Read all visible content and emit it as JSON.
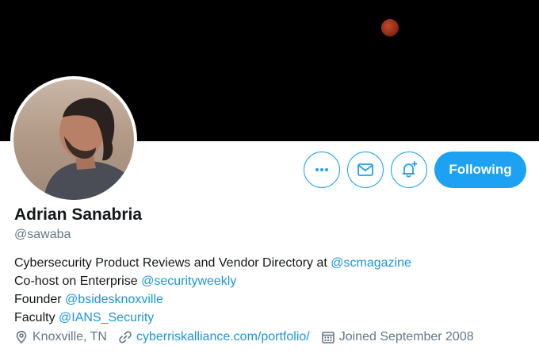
{
  "profile": {
    "name": "Adrian Sanabria",
    "handle": "@sawaba",
    "follow_label": "Following"
  },
  "bio": [
    {
      "text": "Cybersecurity Product Reviews and Vendor Directory at ",
      "link": "@scmagazine"
    },
    {
      "text": "Co-host on Enterprise ",
      "link": "@securityweekly"
    },
    {
      "text": "Founder ",
      "link": "@bsidesknoxville"
    },
    {
      "text": "Faculty ",
      "link": "@IANS_Security"
    }
  ],
  "meta": {
    "location": "Knoxville, TN",
    "website": "cyberriskalliance.com/portfolio/",
    "joined": "Joined September 2008"
  },
  "icons": {
    "more": "more-icon",
    "message": "mail-icon",
    "notify": "bell-plus-icon",
    "location": "location-pin-icon",
    "link": "link-icon",
    "calendar": "calendar-icon"
  },
  "colors": {
    "accent": "#1da1f2",
    "link": "#1b95e0",
    "secondary_text": "#657786",
    "banner": "#000000"
  }
}
